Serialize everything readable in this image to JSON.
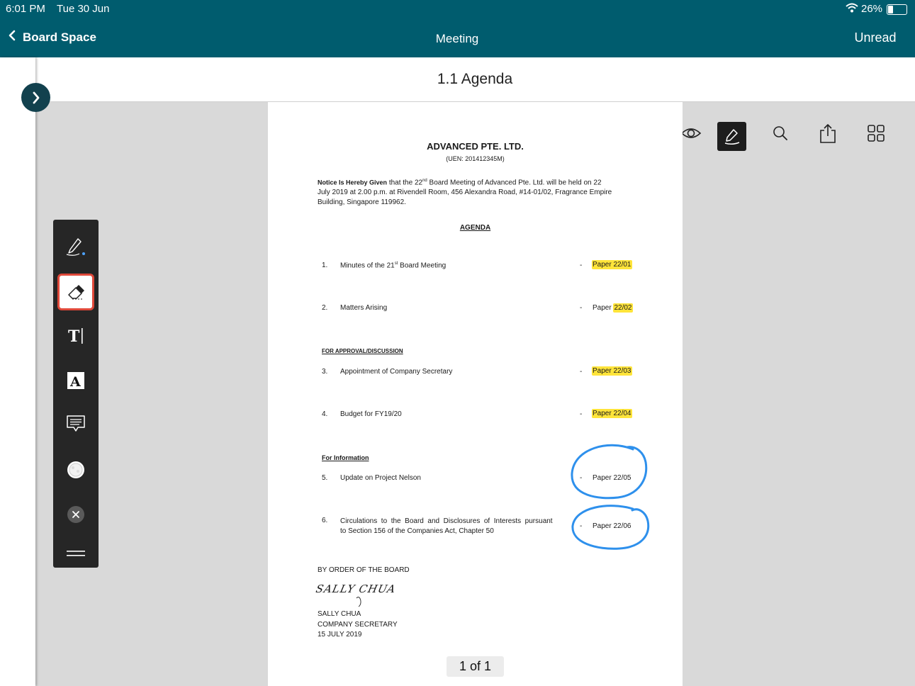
{
  "status_bar": {
    "time": "6:01 PM",
    "date": "Tue 30 Jun",
    "battery": "26%"
  },
  "nav": {
    "back_label": "Board Space",
    "title": "Meeting",
    "unread_label": "Unread"
  },
  "toolbar": {
    "document_title": "1.1 Agenda",
    "icons": [
      "info-icon",
      "eye-icon",
      "annotate-icon",
      "search-icon",
      "share-icon",
      "grid-icon"
    ]
  },
  "document": {
    "company": "ADVANCED PTE. LTD.",
    "uen": "(UEN: 201412345M)",
    "notice": {
      "lead": "Notice Is Hereby Given",
      "text1": " that the 22",
      "sup": "nd",
      "text2": " Board Meeting of Advanced Pte. Ltd. will be held on 22",
      "line2": "July 2019 at 2.00 p.m. at Rivendell Room, 456 Alexandra Road, #14-01/02, Fragrance Empire",
      "line3": "Building, Singapore 119962."
    },
    "agenda_heading": "AGENDA",
    "section_approval": "For Approval/Discussion",
    "section_information": "For Information",
    "items": [
      {
        "num": "1.",
        "text": "Minutes of the 21",
        "sup": "st",
        "text_after": " Board Meeting",
        "paper": "Paper 22/01"
      },
      {
        "num": "2.",
        "text": "Matters Arising",
        "paper_prefix": "Paper ",
        "paper_num": "22/02"
      },
      {
        "num": "3.",
        "text": "Appointment of Company Secretary",
        "paper": "Paper 22/03"
      },
      {
        "num": "4.",
        "text": "Budget for FY19/20",
        "paper": "Paper 22/04"
      },
      {
        "num": "5.",
        "text": "Update on Project Nelson",
        "paper": "Paper 22/05"
      },
      {
        "num": "6.",
        "text_line1": "Circulations  to  the  Board  and  Disclosures  of  Interests  pursuant",
        "text_line2": "to Section 156 of the Companies Act, Chapter 50",
        "paper": "Paper 22/06"
      }
    ],
    "dash": "-",
    "by_order": "BY ORDER OF THE BOARD",
    "signature": "SALLY CHUA",
    "signatory_name": "SALLY CHUA",
    "signatory_title": "COMPANY SECRETARY",
    "signed_date": "15 JULY 2019"
  },
  "pager": {
    "label": "1 of 1"
  },
  "drawing_tools": [
    "pen-icon",
    "eraser-icon",
    "text-cursor-icon",
    "text-box-icon",
    "comment-icon",
    "color-picker-icon",
    "close-icon",
    "menu-icon"
  ],
  "colors": {
    "header": "#005c6e",
    "highlight": "#ffe43a",
    "ink": "#2e90ec",
    "selected_tool_border": "#e0493a"
  }
}
